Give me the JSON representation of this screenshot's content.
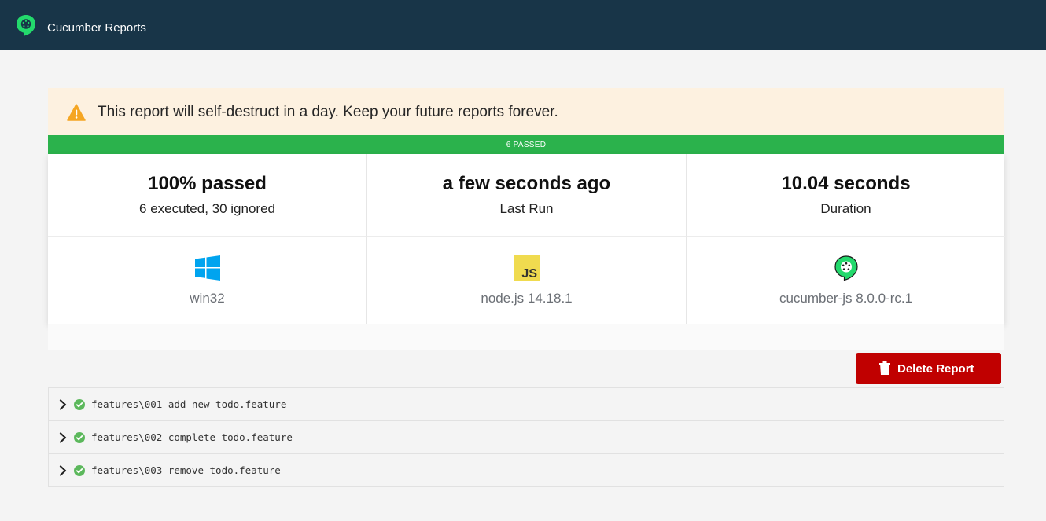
{
  "header": {
    "brand": "Cucumber Reports",
    "logo_icon": "cucumber-logo-icon"
  },
  "banner": {
    "icon": "warning-icon",
    "message": "This report will self-destruct in a day. Keep your future reports forever."
  },
  "status_bar": {
    "label": "6 PASSED",
    "color": "#2bb24c"
  },
  "summary": {
    "pass_rate": "100% passed",
    "executed": "6 executed, 30 ignored",
    "last_run_value": "a few seconds ago",
    "last_run_label": "Last Run",
    "duration_value": "10.04 seconds",
    "duration_label": "Duration"
  },
  "environment": {
    "os": {
      "icon": "windows-icon",
      "label": "win32"
    },
    "runtime": {
      "icon": "javascript-icon",
      "label": "node.js 14.18.1",
      "glyph": "JS"
    },
    "tool": {
      "icon": "cucumber-icon",
      "label": "cucumber-js 8.0.0-rc.1"
    }
  },
  "actions": {
    "delete_label": "Delete Report",
    "delete_color": "#c00000"
  },
  "features": [
    {
      "path": "features\\001-add-new-todo.feature",
      "status": "passed"
    },
    {
      "path": "features\\002-complete-todo.feature",
      "status": "passed"
    },
    {
      "path": "features\\003-remove-todo.feature",
      "status": "passed"
    }
  ]
}
